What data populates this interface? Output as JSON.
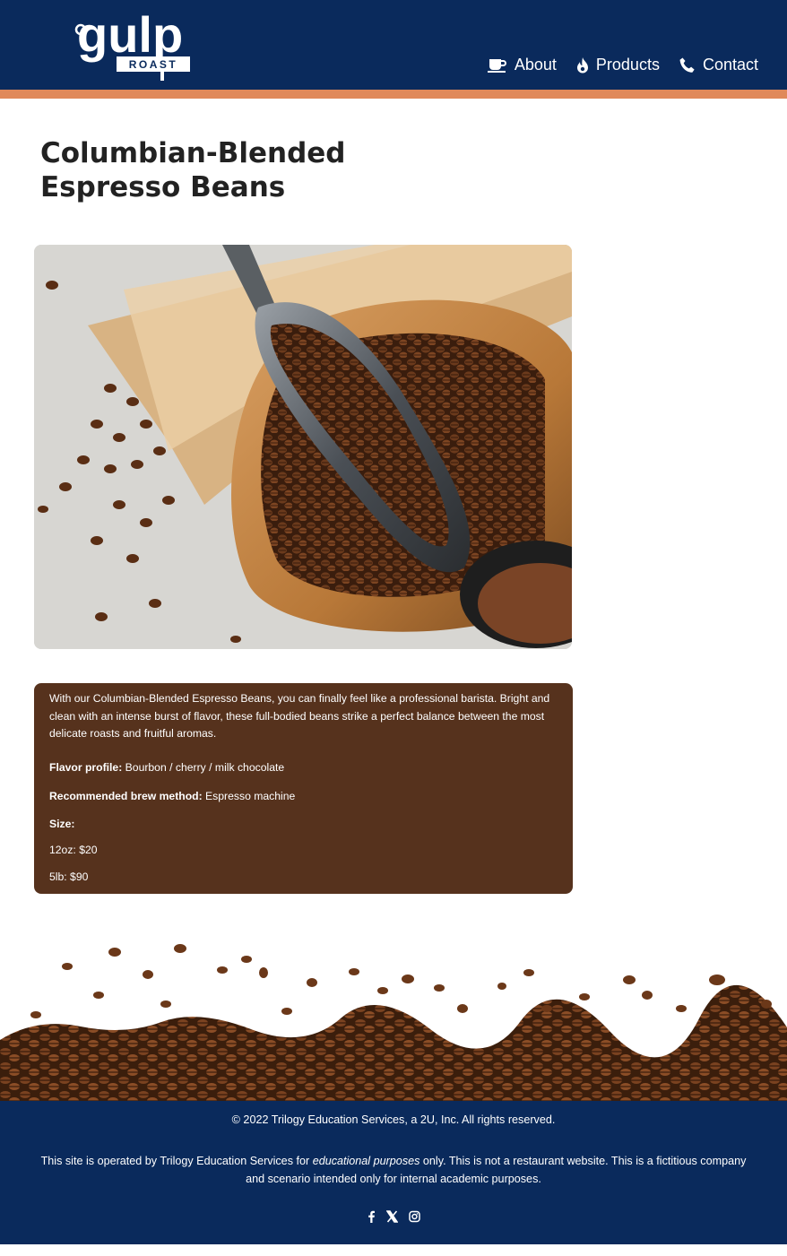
{
  "header": {
    "logo_text": "gulp",
    "logo_sub": "ROAST",
    "nav": [
      {
        "label": "About",
        "icon": "coffee-cup-icon"
      },
      {
        "label": "Products",
        "icon": "flame-icon"
      },
      {
        "label": "Contact",
        "icon": "phone-icon"
      }
    ],
    "colors": {
      "navy": "#0a2a5c",
      "accent": "#e0895a"
    }
  },
  "product": {
    "title": "Columbian-Blended Espresso Beans",
    "description": "With our Columbian-Blended Espresso Beans, you can finally feel like a professional barista. Bright and clean with an intense burst of flavor, these full-bodied beans strike a perfect balance between the most delicate roasts and fruitful aromas.",
    "flavor_label": "Flavor profile:",
    "flavor_value": "Bourbon / cherry / milk chocolate",
    "brew_label": "Recommended brew method:",
    "brew_value": "Espresso machine",
    "size_label": "Size:",
    "sizes": [
      "12oz: $20",
      "5lb: $90"
    ],
    "panel_color": "#56321d"
  },
  "footer": {
    "copyright": "© 2022 Trilogy Education Services, a 2U, Inc. All rights reserved.",
    "disclaimer_before": "This site is operated by Trilogy Education Services for ",
    "disclaimer_em": "educational purposes",
    "disclaimer_after": " only. This is not a restaurant website. This is a fictitious company and scenario intended only for internal academic purposes.",
    "social": [
      "facebook-icon",
      "x-icon",
      "instagram-icon"
    ]
  }
}
